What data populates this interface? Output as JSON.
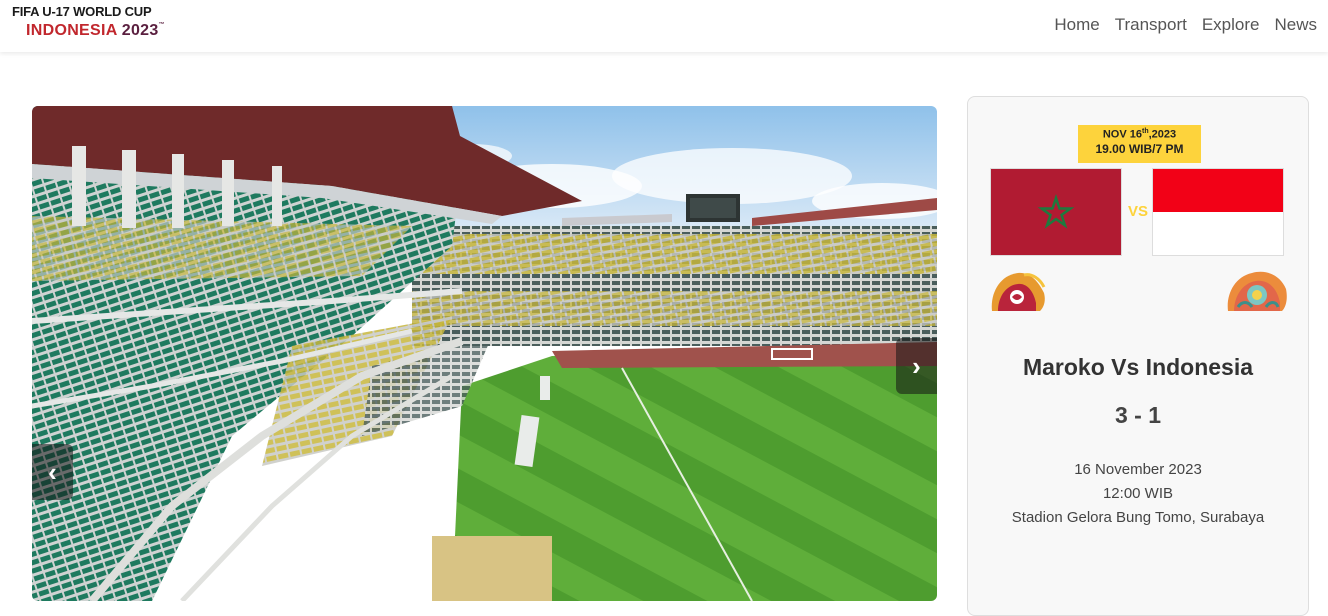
{
  "brand": {
    "line1": "FIFA U-17 WORLD CUP",
    "line2_country": "INDONESIA",
    "line2_year": "2023",
    "tm": "™"
  },
  "nav": {
    "items": [
      "Home",
      "Transport",
      "Explore",
      "News"
    ]
  },
  "carousel": {
    "prev_glyph": "‹",
    "next_glyph": "›",
    "image_subject": "stadium"
  },
  "match": {
    "badge_date": "NOV 16",
    "badge_date_suffix": "th",
    "badge_year": ",2023",
    "badge_time": "19.00 WIB/7 PM",
    "vs": "VS",
    "title": "Maroko Vs Indonesia",
    "score": "3 - 1",
    "date": "16 November 2023",
    "time": "12:00 WIB",
    "venue": "Stadion Gelora Bung Tomo, Surabaya"
  },
  "colors": {
    "badge": "#fdd33c",
    "morocco_red": "#b11b32",
    "indonesia_red": "#f20117",
    "brand_red": "#c1272d"
  }
}
